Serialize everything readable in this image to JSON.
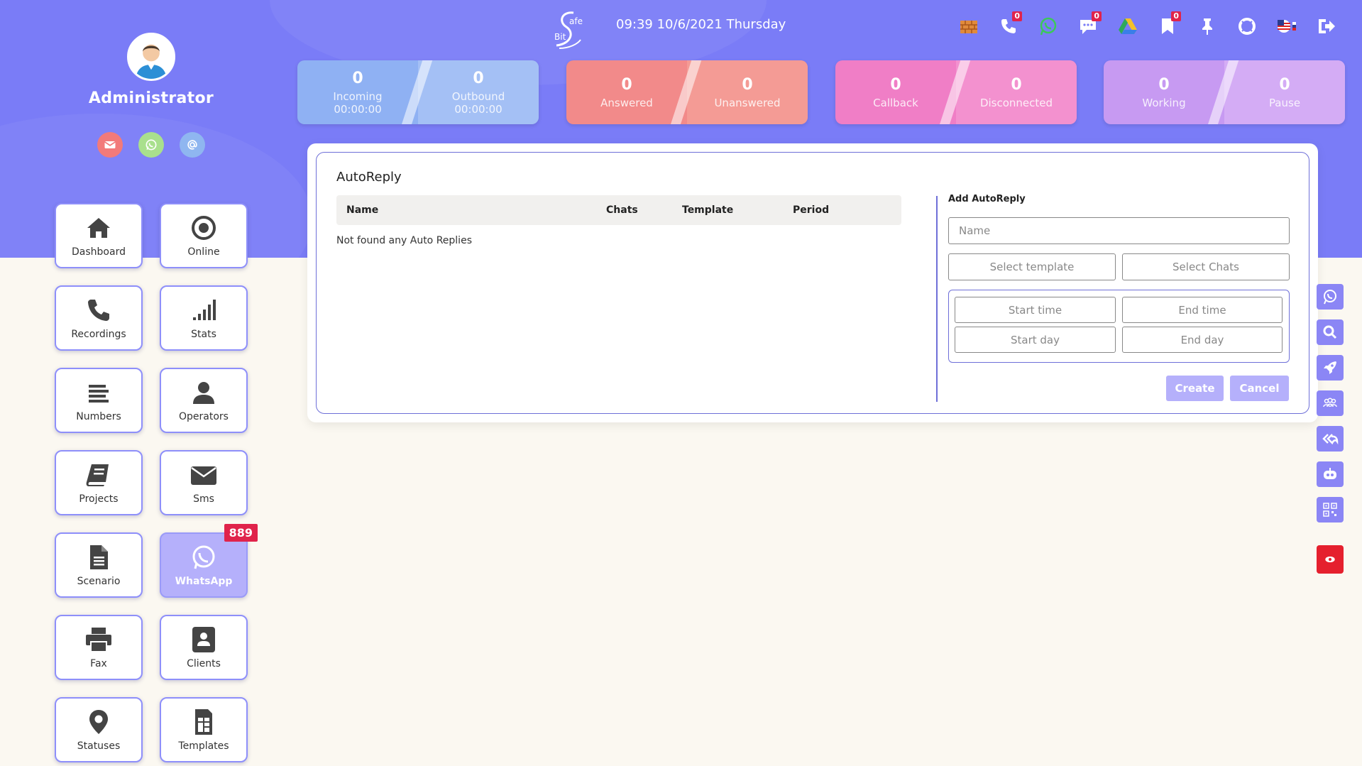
{
  "profile": {
    "name": "Administrator"
  },
  "header": {
    "clock": "09:39 10/6/2021 Thursday",
    "logo_top": "afe",
    "logo_bottom": "Bit"
  },
  "top_icons": [
    {
      "icon": "firewall-icon",
      "badge": ""
    },
    {
      "icon": "phone-callback-icon",
      "badge": "0"
    },
    {
      "icon": "whatsapp-icon",
      "badge": ""
    },
    {
      "icon": "chat-bubble-icon",
      "badge": "0"
    },
    {
      "icon": "google-drive-icon",
      "badge": ""
    },
    {
      "icon": "bookmark-icon",
      "badge": "0"
    },
    {
      "icon": "pin-icon",
      "badge": ""
    },
    {
      "icon": "lifebuoy-icon",
      "badge": ""
    },
    {
      "icon": "language-flag-icon",
      "badge": ""
    },
    {
      "icon": "logout-icon",
      "badge": ""
    }
  ],
  "stats": [
    {
      "left": {
        "num": "0",
        "cap": "Incoming",
        "sub": "00:00:00"
      },
      "right": {
        "num": "0",
        "cap": "Outbound",
        "sub": "00:00:00"
      }
    },
    {
      "left": {
        "num": "0",
        "cap": "Answered"
      },
      "right": {
        "num": "0",
        "cap": "Unanswered"
      }
    },
    {
      "left": {
        "num": "0",
        "cap": "Callback"
      },
      "right": {
        "num": "0",
        "cap": "Disconnected"
      }
    },
    {
      "left": {
        "num": "0",
        "cap": "Working"
      },
      "right": {
        "num": "0",
        "cap": "Pause"
      }
    }
  ],
  "nav": [
    {
      "label": "Dashboard",
      "icon": "home-icon"
    },
    {
      "label": "Online",
      "icon": "radio-target-icon"
    },
    {
      "label": "Recordings",
      "icon": "phone-icon"
    },
    {
      "label": "Stats",
      "icon": "signal-bars-icon"
    },
    {
      "label": "Numbers",
      "icon": "list-lines-icon"
    },
    {
      "label": "Operators",
      "icon": "user-icon"
    },
    {
      "label": "Projects",
      "icon": "book-icon"
    },
    {
      "label": "Sms",
      "icon": "envelope-icon"
    },
    {
      "label": "Scenario",
      "icon": "document-icon"
    },
    {
      "label": "WhatsApp",
      "icon": "whatsapp-icon",
      "badge": "889"
    },
    {
      "label": "Fax",
      "icon": "printer-icon"
    },
    {
      "label": "Clients",
      "icon": "contact-card-icon"
    },
    {
      "label": "Statuses",
      "icon": "map-pin-icon"
    },
    {
      "label": "Templates",
      "icon": "template-icon"
    }
  ],
  "autoreply": {
    "title": "AutoReply",
    "columns": [
      "Name",
      "Chats",
      "Template",
      "Period"
    ],
    "empty_message": "Not found any Auto Replies",
    "form_title": "Add AutoReply",
    "name_placeholder": "Name",
    "select_template": "Select template",
    "select_chats": "Select Chats",
    "start_time": "Start time",
    "end_time": "End time",
    "start_day": "Start day",
    "end_day": "End day",
    "create_label": "Create",
    "cancel_label": "Cancel"
  },
  "colors": {
    "brand": "#7a7cf7",
    "incoming": "#8fb1f3",
    "answered": "#f28a8a",
    "callback": "#f07ec6",
    "working": "#c79af2",
    "badge": "#e0234b",
    "alert": "#e5202e"
  }
}
